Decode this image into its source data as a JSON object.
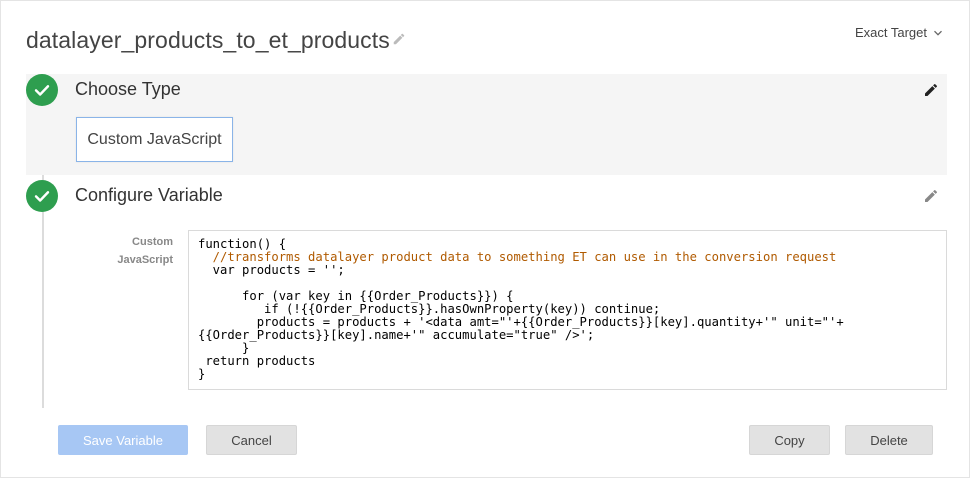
{
  "header": {
    "title": "datalayer_products_to_et_products",
    "account_label": "Exact Target"
  },
  "steps": {
    "choose_type": {
      "title": "Choose Type",
      "selected_type": "Custom JavaScript"
    },
    "configure": {
      "title": "Configure Variable",
      "field_label_line1": "Custom",
      "field_label_line2": "JavaScript"
    }
  },
  "code": {
    "lines": [
      "function() {",
      "  //transforms datalayer product data to something ET can use in the conversion request",
      "  var products = '';",
      "",
      "      for (var key in {{Order_Products}}) {",
      "         if (!{{Order_Products}}.hasOwnProperty(key)) continue;",
      "        products = products + '<data amt=\"'+{{Order_Products}}[key].quantity+'\" unit=\"'+",
      "{{Order_Products}}[key].name+'\" accumulate=\"true\" />';",
      "      }",
      " return products",
      "}"
    ]
  },
  "buttons": {
    "save": "Save Variable",
    "cancel": "Cancel",
    "copy": "Copy",
    "delete": "Delete"
  },
  "colors": {
    "accent_green": "#2e9e4f",
    "save_disabled": "#a7c7f4"
  },
  "icons": {
    "title_edit": "pencil-icon",
    "account_dropdown": "chevron-down-icon",
    "step_complete": "check-icon",
    "step_edit": "pencil-icon"
  }
}
